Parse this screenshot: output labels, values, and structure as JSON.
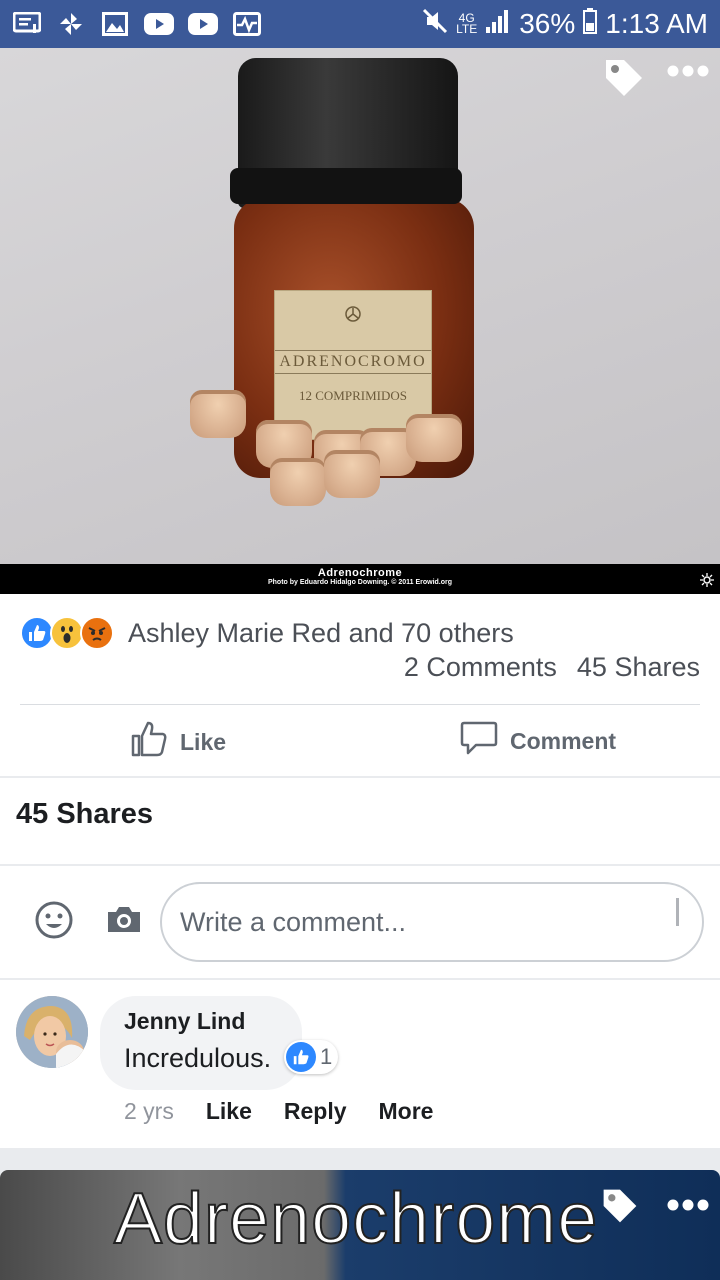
{
  "status_bar": {
    "battery": "36%",
    "time": "1:13 AM",
    "network_top": "4G",
    "network_bottom": "LTE"
  },
  "photo": {
    "label_title": "ADRENOCROMO",
    "label_sub": "12 COMPRIMIDOS",
    "caption_title": "Adrenochrome",
    "caption_credit": "Photo by Eduardo Hidalgo Downing. © 2011 Erowid.org"
  },
  "reactions": {
    "icons": [
      "like-reaction",
      "wow-reaction",
      "angry-reaction"
    ],
    "summary": "Ashley Marie Red and 70 others",
    "comments_count": "2 Comments",
    "shares_count": "45 Shares"
  },
  "actions": {
    "like": "Like",
    "comment": "Comment"
  },
  "shares_section": {
    "title": "45 Shares"
  },
  "composer": {
    "placeholder": "Write a comment..."
  },
  "comment": {
    "author": "Jenny Lind",
    "text": "Incredulous.",
    "like_count": "1",
    "age": "2 yrs",
    "like": "Like",
    "reply": "Reply",
    "more": "More"
  },
  "next_post": {
    "title": "Adrenochrome"
  },
  "colors": {
    "brand": "#3b5998",
    "like_blue": "#2d88ff",
    "text_primary": "#1c1e21",
    "text_secondary": "#606770"
  }
}
